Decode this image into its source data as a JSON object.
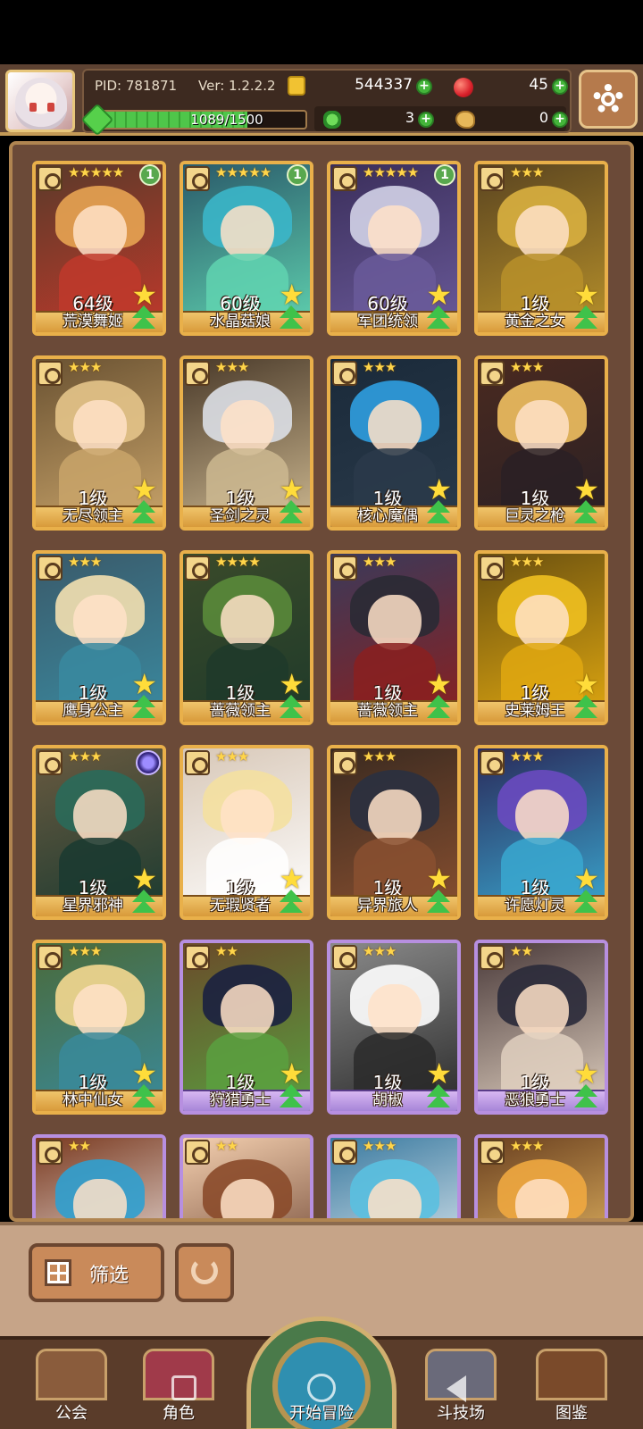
{
  "header": {
    "pid": "PID: 781871",
    "version": "Ver: 1.2.2.2",
    "gold": "544337",
    "apples": "45",
    "clovers": "3",
    "meat": "0",
    "exp_text": "1089/1500",
    "exp_fraction": 0.726
  },
  "cards": [
    {
      "name": "荒漠舞姬",
      "level": "64级",
      "stars": "★★★★★",
      "count": "1",
      "frame": "gold",
      "palette": [
        "#e7a452",
        "#c0392b",
        "#5a3a2a"
      ]
    },
    {
      "name": "水晶菇娘",
      "level": "60级",
      "stars": "★★★★★",
      "count": "1",
      "frame": "gold",
      "palette": [
        "#3bb6c9",
        "#60d3b0",
        "#2a5a6a"
      ]
    },
    {
      "name": "军团统领",
      "level": "60级",
      "stars": "★★★★★",
      "count": "1",
      "frame": "gold",
      "palette": [
        "#d3d3e8",
        "#6a5a9a",
        "#3a2e5a"
      ]
    },
    {
      "name": "黄金之女",
      "level": "1级",
      "stars": "★★★",
      "count": "",
      "frame": "gold",
      "palette": [
        "#d9b040",
        "#b8912a",
        "#5a4420"
      ]
    },
    {
      "name": "无尽领主",
      "level": "1级",
      "stars": "★★★",
      "count": "",
      "frame": "gold",
      "palette": [
        "#e4c48a",
        "#c9a46a",
        "#6a5232"
      ]
    },
    {
      "name": "圣剑之灵",
      "level": "1级",
      "stars": "★★★",
      "count": "",
      "frame": "gold",
      "palette": [
        "#dcdfe6",
        "#cdb890",
        "#4a3a2a"
      ]
    },
    {
      "name": "核心魔偶",
      "level": "1级",
      "stars": "★★★",
      "count": "",
      "frame": "gold",
      "palette": [
        "#2f9fe0",
        "#2a3a4a",
        "#1a2a3a"
      ]
    },
    {
      "name": "巨灵之枪",
      "level": "1级",
      "stars": "★★★",
      "count": "",
      "frame": "gold",
      "palette": [
        "#f0c060",
        "#2a2024",
        "#4a2a20"
      ]
    },
    {
      "name": "鹰身公主",
      "level": "1级",
      "stars": "★★★",
      "count": "",
      "frame": "gold",
      "palette": [
        "#f4e0b0",
        "#3a8aa0",
        "#3a5a6a"
      ]
    },
    {
      "name": "蔷薇领主",
      "level": "1级",
      "stars": "★★★★",
      "count": "",
      "frame": "gold",
      "palette": [
        "#5a8a3a",
        "#1f3a2a",
        "#3a4a2a"
      ]
    },
    {
      "name": "蔷薇领主",
      "level": "1级",
      "stars": "★★★",
      "count": "",
      "frame": "gold",
      "palette": [
        "#2a2a34",
        "#8a2020",
        "#3a3a5a"
      ]
    },
    {
      "name": "史莱姆王",
      "level": "1级",
      "stars": "★★★",
      "count": "",
      "frame": "gold",
      "palette": [
        "#f0c020",
        "#e0a810",
        "#6a5010"
      ]
    },
    {
      "name": "星界邪神",
      "level": "1级",
      "stars": "★★★",
      "count": "",
      "frame": "gold",
      "palette": [
        "#2a6a5a",
        "#1a3a30",
        "#6a5a40"
      ],
      "orb": true
    },
    {
      "name": "无瑕贤者",
      "level": "1级",
      "stars": "★★★",
      "count": "",
      "frame": "gold",
      "palette": [
        "#f4e0a0",
        "#ffffff",
        "#d8c8b8"
      ]
    },
    {
      "name": "异界旅人",
      "level": "1级",
      "stars": "★★★",
      "count": "",
      "frame": "gold",
      "palette": [
        "#2a3040",
        "#8a5030",
        "#3a2a20"
      ]
    },
    {
      "name": "许愿灯灵",
      "level": "1级",
      "stars": "★★★",
      "count": "",
      "frame": "gold",
      "palette": [
        "#6a4ac0",
        "#3aa8d0",
        "#2a2a5a"
      ]
    },
    {
      "name": "林中仙女",
      "level": "1级",
      "stars": "★★★",
      "count": "",
      "frame": "gold",
      "palette": [
        "#f4d890",
        "#3a8a9a",
        "#4a6a3a"
      ]
    },
    {
      "name": "狩猎勇士",
      "level": "1级",
      "stars": "★★",
      "count": "",
      "frame": "purple",
      "palette": [
        "#1a2040",
        "#5aa040",
        "#6a4a2a"
      ]
    },
    {
      "name": "胡椒",
      "level": "1级",
      "stars": "★★★",
      "count": "",
      "frame": "purple",
      "palette": [
        "#ffffff",
        "#2a2a2a",
        "#8a8a8a"
      ]
    },
    {
      "name": "恶狼勇士",
      "level": "1级",
      "stars": "★★",
      "count": "",
      "frame": "purple",
      "palette": [
        "#2a2a3a",
        "#e0d0c0",
        "#4a3a3a"
      ]
    },
    {
      "name": "",
      "level": "",
      "stars": "★★",
      "count": "",
      "frame": "purple",
      "palette": [
        "#2fa0d0",
        "#ffffff",
        "#7a3a20"
      ]
    },
    {
      "name": "",
      "level": "",
      "stars": "★★",
      "count": "",
      "frame": "purple",
      "palette": [
        "#8a4a2a",
        "#5a3020",
        "#f4d0b0"
      ]
    },
    {
      "name": "",
      "level": "",
      "stars": "★★★",
      "count": "",
      "frame": "purple",
      "palette": [
        "#5ac0e0",
        "#ffffff",
        "#3a7aa0"
      ]
    },
    {
      "name": "",
      "level": "",
      "stars": "★★★",
      "count": "",
      "frame": "purple",
      "palette": [
        "#f0a840",
        "#ffd070",
        "#6a4020"
      ]
    }
  ],
  "toolbar": {
    "filter_label": "筛选"
  },
  "nav": {
    "guild": "公会",
    "character": "角色",
    "adventure": "开始冒险",
    "arena": "斗技场",
    "codex": "图鉴"
  }
}
